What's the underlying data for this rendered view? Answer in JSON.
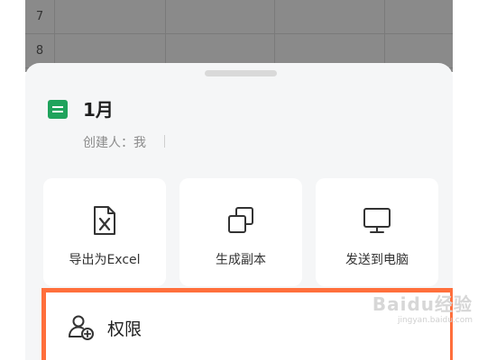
{
  "spreadsheet": {
    "row_numbers": [
      "7",
      "8"
    ]
  },
  "file": {
    "icon": "sheet-file-icon",
    "title": "1月",
    "creator": "创建人：我"
  },
  "actions": [
    {
      "label": "导出为Excel",
      "icon": "excel-export-icon"
    },
    {
      "label": "生成副本",
      "icon": "copy-icon"
    },
    {
      "label": "发送到电脑",
      "icon": "monitor-icon"
    }
  ],
  "permissions": {
    "label": "权限",
    "icon": "user-add-icon"
  },
  "watermark": {
    "text": "Baidu经验",
    "sub": "jingyan.baidu.com"
  },
  "colors": {
    "highlight": "#ff6f3c",
    "sheet_icon": "#1fa35c"
  }
}
